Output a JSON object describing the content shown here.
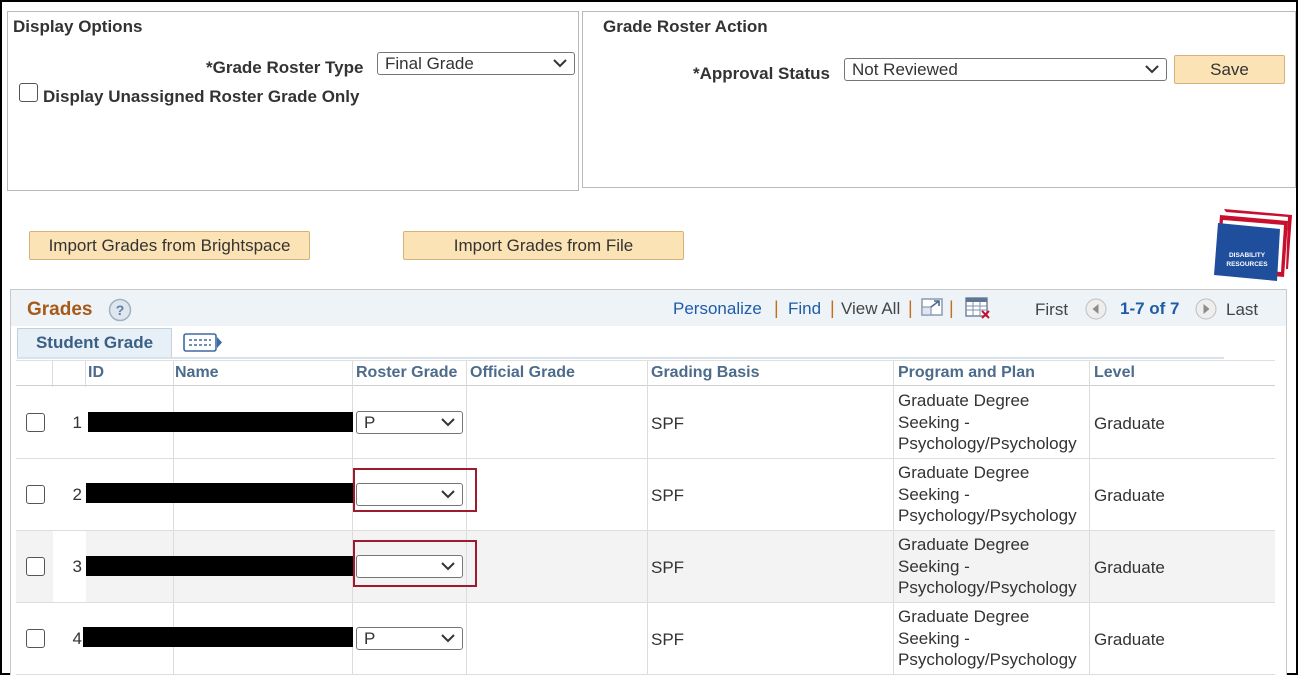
{
  "display_options": {
    "title": "Display Options",
    "roster_type_label": "*Grade Roster Type",
    "roster_type_value": "Final Grade",
    "unassigned_label": "Display Unassigned Roster Grade Only",
    "unassigned_checked": false
  },
  "roster_action": {
    "title": "Grade Roster Action",
    "approval_label": "*Approval Status",
    "approval_value": "Not Reviewed",
    "save_label": "Save"
  },
  "actions": {
    "import_brightspace": "Import Grades from Brightspace",
    "import_file": "Import Grades from File"
  },
  "logo": {
    "line1": "DISABILITY",
    "line2": "RESOURCES",
    "colors": [
      "#c8102e",
      "#1f4e9c"
    ]
  },
  "grades": {
    "title": "Grades",
    "toolbar": {
      "personalize": "Personalize",
      "find": "Find",
      "view_all": "View All",
      "first": "First",
      "range": "1-7 of 7",
      "last": "Last"
    },
    "tab": "Student Grade",
    "columns": {
      "id": "ID",
      "name": "Name",
      "roster_grade": "Roster Grade",
      "official_grade": "Official Grade",
      "grading_basis": "Grading Basis",
      "program_plan": "Program and Plan",
      "level": "Level"
    },
    "rows": [
      {
        "num": "1",
        "roster_grade": "P",
        "grading_basis": "SPF",
        "program_1": "Graduate Degree",
        "program_2": "Seeking -",
        "program_3": "Psychology/Psychology",
        "level": "Graduate"
      },
      {
        "num": "2",
        "roster_grade": "",
        "grading_basis": "SPF",
        "program_1": "Graduate Degree",
        "program_2": "Seeking -",
        "program_3": "Psychology/Psychology",
        "level": "Graduate"
      },
      {
        "num": "3",
        "roster_grade": "",
        "grading_basis": "SPF",
        "program_1": "Graduate Degree",
        "program_2": "Seeking -",
        "program_3": "Psychology/Psychology",
        "level": "Graduate"
      },
      {
        "num": "4",
        "roster_grade": "P",
        "grading_basis": "SPF",
        "program_1": "Graduate Degree",
        "program_2": "Seeking -",
        "program_3": "Psychology/Psychology",
        "level": "Graduate"
      }
    ]
  }
}
